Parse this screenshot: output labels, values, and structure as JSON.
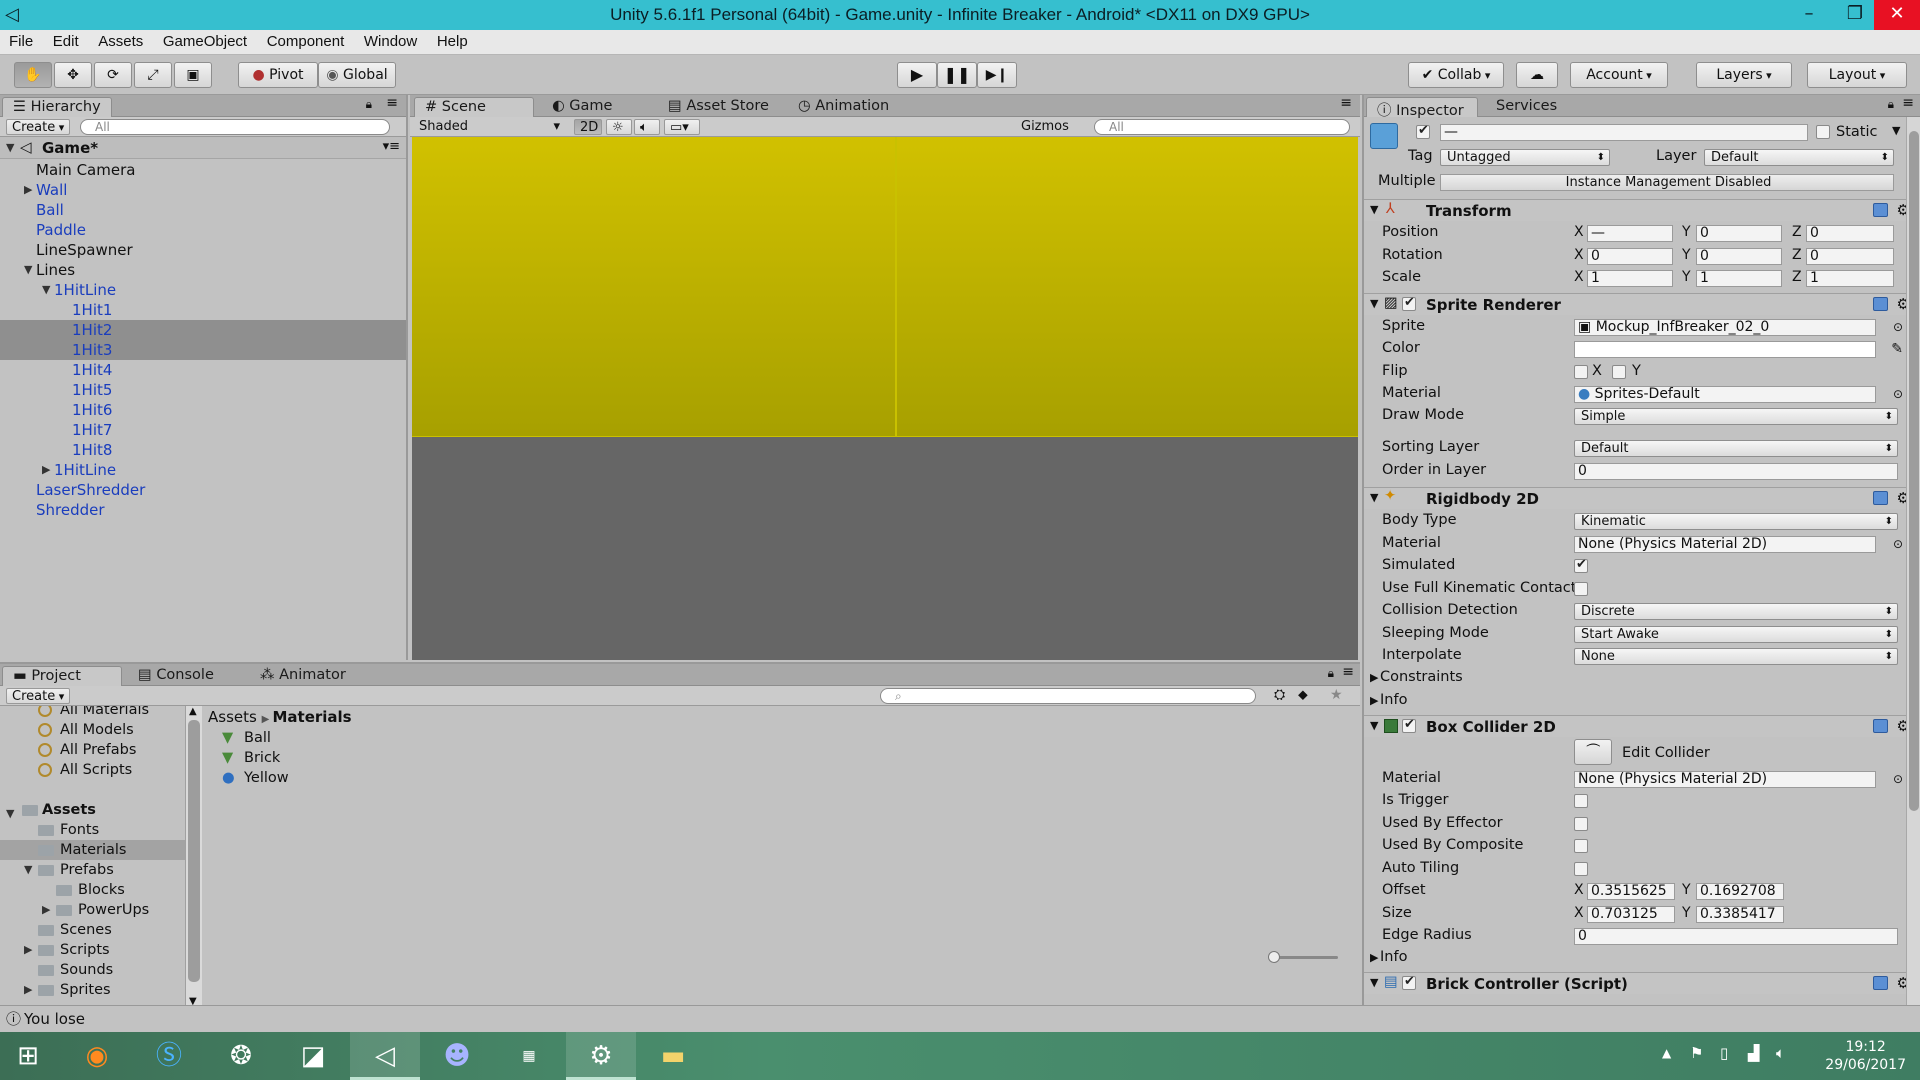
{
  "window": {
    "title": "Unity 5.6.1f1 Personal (64bit) - Game.unity - Infinite Breaker - Android* <DX11 on DX9 GPU>"
  },
  "menu": [
    "File",
    "Edit",
    "Assets",
    "GameObject",
    "Component",
    "Window",
    "Help"
  ],
  "toolbar": {
    "pivot": "Pivot",
    "global": "Global",
    "collab": "Collab",
    "account": "Account",
    "layers": "Layers",
    "layout": "Layout"
  },
  "hierarchy": {
    "tab": "Hierarchy",
    "create": "Create",
    "search_placeholder": "All",
    "scene_name": "Game*",
    "items": [
      {
        "label": "Main Camera",
        "depth": 0,
        "blue": false,
        "arrow": "",
        "selected": false
      },
      {
        "label": "Wall",
        "depth": 0,
        "blue": true,
        "arrow": "collapsed",
        "selected": false
      },
      {
        "label": "Ball",
        "depth": 0,
        "blue": true,
        "arrow": "",
        "selected": false
      },
      {
        "label": "Paddle",
        "depth": 0,
        "blue": true,
        "arrow": "",
        "selected": false
      },
      {
        "label": "LineSpawner",
        "depth": 0,
        "blue": false,
        "arrow": "",
        "selected": false
      },
      {
        "label": "Lines",
        "depth": 0,
        "blue": false,
        "arrow": "expanded",
        "selected": false
      },
      {
        "label": "1HitLine",
        "depth": 1,
        "blue": true,
        "arrow": "expanded",
        "selected": false
      },
      {
        "label": "1Hit1",
        "depth": 2,
        "blue": true,
        "arrow": "",
        "selected": false
      },
      {
        "label": "1Hit2",
        "depth": 2,
        "blue": true,
        "arrow": "",
        "selected": true
      },
      {
        "label": "1Hit3",
        "depth": 2,
        "blue": true,
        "arrow": "",
        "selected": true
      },
      {
        "label": "1Hit4",
        "depth": 2,
        "blue": true,
        "arrow": "",
        "selected": false
      },
      {
        "label": "1Hit5",
        "depth": 2,
        "blue": true,
        "arrow": "",
        "selected": false
      },
      {
        "label": "1Hit6",
        "depth": 2,
        "blue": true,
        "arrow": "",
        "selected": false
      },
      {
        "label": "1Hit7",
        "depth": 2,
        "blue": true,
        "arrow": "",
        "selected": false
      },
      {
        "label": "1Hit8",
        "depth": 2,
        "blue": true,
        "arrow": "",
        "selected": false
      },
      {
        "label": "1HitLine",
        "depth": 1,
        "blue": true,
        "arrow": "collapsed",
        "selected": false
      },
      {
        "label": "LaserShredder",
        "depth": 0,
        "blue": true,
        "arrow": "",
        "selected": false
      },
      {
        "label": "Shredder",
        "depth": 0,
        "blue": true,
        "arrow": "",
        "selected": false
      }
    ]
  },
  "scene": {
    "tabs": [
      "Scene",
      "Game",
      "Asset Store",
      "Animation"
    ],
    "shading": "Shaded",
    "mode_2d": "2D",
    "gizmos": "Gizmos",
    "search_placeholder": "All"
  },
  "inspector": {
    "tabs": [
      "Inspector",
      "Services"
    ],
    "name_value": "—",
    "static_label": "Static",
    "tag_label": "Tag",
    "tag_value": "Untagged",
    "layer_label": "Layer",
    "layer_value": "Default",
    "multiple_label": "Multiple",
    "multiple_value": "Instance Management Disabled",
    "transform": {
      "title": "Transform",
      "position_label": "Position",
      "position": {
        "x": "—",
        "y": "0",
        "z": "0"
      },
      "rotation_label": "Rotation",
      "rotation": {
        "x": "0",
        "y": "0",
        "z": "0"
      },
      "scale_label": "Scale",
      "scale": {
        "x": "1",
        "y": "1",
        "z": "1"
      }
    },
    "sprite_renderer": {
      "title": "Sprite Renderer",
      "sprite_label": "Sprite",
      "sprite_value": "Mockup_InfBreaker_02_0",
      "color_label": "Color",
      "flip_label": "Flip",
      "flip_x": "X",
      "flip_y": "Y",
      "material_label": "Material",
      "material_value": "Sprites-Default",
      "draw_mode_label": "Draw Mode",
      "draw_mode_value": "Simple",
      "sorting_layer_label": "Sorting Layer",
      "sorting_layer_value": "Default",
      "order_label": "Order in Layer",
      "order_value": "0"
    },
    "rigidbody": {
      "title": "Rigidbody 2D",
      "body_type_label": "Body Type",
      "body_type_value": "Kinematic",
      "material_label": "Material",
      "material_value": "None (Physics Material 2D)",
      "simulated_label": "Simulated",
      "full_kinematic_label": "Use Full Kinematic Contact",
      "collision_label": "Collision Detection",
      "collision_value": "Discrete",
      "sleeping_label": "Sleeping Mode",
      "sleeping_value": "Start Awake",
      "interpolate_label": "Interpolate",
      "interpolate_value": "None",
      "constraints_label": "Constraints",
      "info_label": "Info"
    },
    "box_collider": {
      "title": "Box Collider 2D",
      "edit_collider": "Edit Collider",
      "material_label": "Material",
      "material_value": "None (Physics Material 2D)",
      "trigger_label": "Is Trigger",
      "effector_label": "Used By Effector",
      "composite_label": "Used By Composite",
      "autotiling_label": "Auto Tiling",
      "offset_label": "Offset",
      "offset": {
        "x": "0.3515625",
        "y": "0.1692708"
      },
      "size_label": "Size",
      "size": {
        "x": "0.703125",
        "y": "0.3385417"
      },
      "edge_label": "Edge Radius",
      "edge_value": "0",
      "info_label": "Info"
    },
    "brick_controller": {
      "title": "Brick Controller (Script)"
    }
  },
  "project": {
    "tabs": [
      "Project",
      "Console",
      "Animator"
    ],
    "create": "Create",
    "favorites": [
      "All Materials",
      "All Models",
      "All Prefabs",
      "All Scripts"
    ],
    "assets_root": "Assets",
    "folders": [
      {
        "label": "Fonts",
        "depth": 1,
        "arrow": "",
        "selected": false
      },
      {
        "label": "Materials",
        "depth": 1,
        "arrow": "",
        "selected": true
      },
      {
        "label": "Prefabs",
        "depth": 1,
        "arrow": "expanded",
        "selected": false
      },
      {
        "label": "Blocks",
        "depth": 2,
        "arrow": "",
        "selected": false
      },
      {
        "label": "PowerUps",
        "depth": 2,
        "arrow": "collapsed",
        "selected": false
      },
      {
        "label": "Scenes",
        "depth": 1,
        "arrow": "",
        "selected": false
      },
      {
        "label": "Scripts",
        "depth": 1,
        "arrow": "collapsed",
        "selected": false
      },
      {
        "label": "Sounds",
        "depth": 1,
        "arrow": "",
        "selected": false
      },
      {
        "label": "Sprites",
        "depth": 1,
        "arrow": "collapsed",
        "selected": false
      }
    ],
    "breadcrumb": [
      "Assets",
      "Materials"
    ],
    "files": [
      "Ball",
      "Brick",
      "Yellow"
    ]
  },
  "status": {
    "message": "You lose"
  },
  "taskbar": {
    "time": "19:12",
    "date": "29/06/2017"
  },
  "colors": {
    "titlebar": "#36bfcf",
    "scene_yellow": "#c8b800",
    "selection": "#8f8f8f",
    "prefab_blue": "#1a3dbd"
  }
}
